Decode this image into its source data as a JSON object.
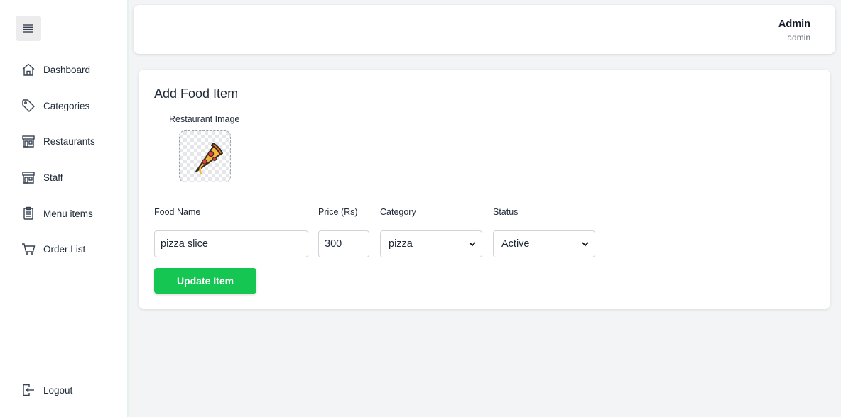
{
  "sidebar": {
    "items": [
      {
        "label": "Dashboard",
        "icon": "home-icon"
      },
      {
        "label": "Categories",
        "icon": "tag-icon"
      },
      {
        "label": "Restaurants",
        "icon": "store-icon"
      },
      {
        "label": "Staff",
        "icon": "store-icon"
      },
      {
        "label": "Menu items",
        "icon": "clipboard-icon"
      },
      {
        "label": "Order List",
        "icon": "cart-icon"
      }
    ],
    "logout_label": "Logout"
  },
  "header": {
    "user_name": "Admin",
    "user_role": "admin"
  },
  "form": {
    "title": "Add Food Item",
    "image_label": "Restaurant Image",
    "food_name_label": "Food Name",
    "food_name_value": "pizza slice",
    "price_label": "Price (Rs)",
    "price_value": "300",
    "category_label": "Category",
    "category_value": "pizza",
    "status_label": "Status",
    "status_value": "Active",
    "submit_label": "Update Item"
  },
  "colors": {
    "accent_green": "#16c653",
    "sidebar_border": "#e3f3e8",
    "page_background": "#f3f4f6"
  }
}
